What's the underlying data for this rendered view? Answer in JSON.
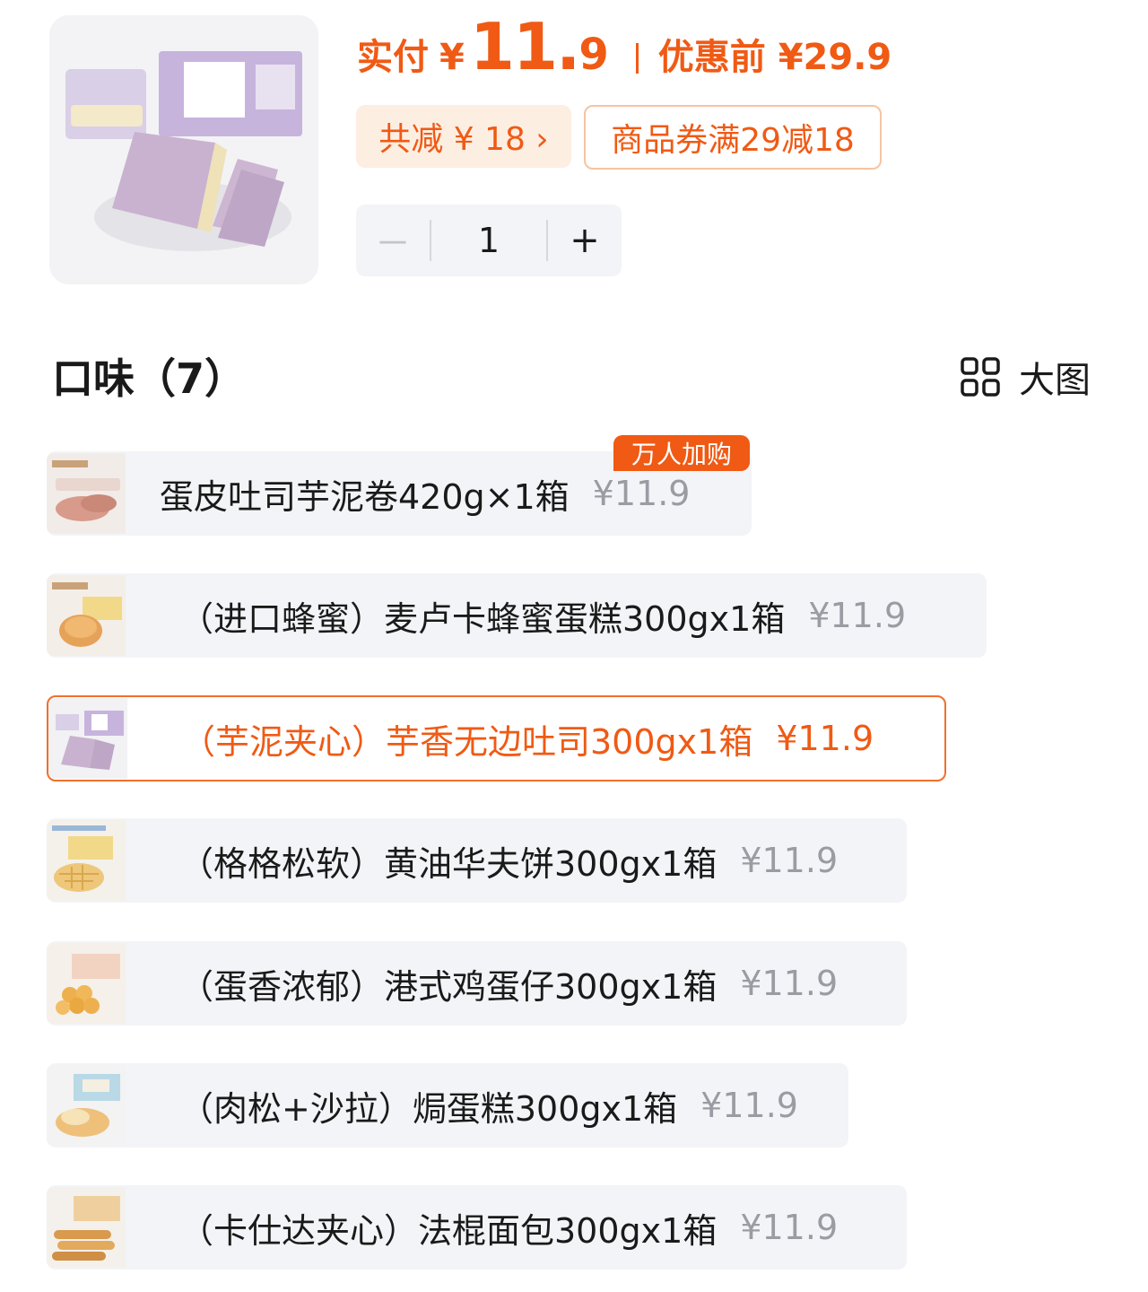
{
  "header": {
    "paid_label": "实付",
    "yen": "¥",
    "price_int": "11.",
    "price_dec": "9",
    "original_label": "优惠前 ¥29.9",
    "discount_tag": "共减 ¥ 18 ›",
    "coupon_tag": "商品券满29减18"
  },
  "stepper": {
    "minus": "－",
    "quantity": "1",
    "plus": "+"
  },
  "section": {
    "title": "口味（7）",
    "view_toggle": "大图"
  },
  "options": [
    {
      "name": "蛋皮吐司芋泥卷420g×1箱",
      "price": "¥11.9",
      "badge": "万人加购",
      "selected": false
    },
    {
      "name": "（进口蜂蜜）麦卢卡蜂蜜蛋糕300gx1箱",
      "price": "¥11.9",
      "selected": false
    },
    {
      "name": "（芋泥夹心）芋香无边吐司300gx1箱",
      "price": "¥11.9",
      "selected": true
    },
    {
      "name": "（格格松软）黄油华夫饼300gx1箱",
      "price": "¥11.9",
      "selected": false
    },
    {
      "name": "（蛋香浓郁）港式鸡蛋仔300gx1箱",
      "price": "¥11.9",
      "selected": false
    },
    {
      "name": "（肉松+沙拉）焗蛋糕300gx1箱",
      "price": "¥11.9",
      "selected": false
    },
    {
      "name": "（卡仕达夹心）法棍面包300gx1箱",
      "price": "¥11.9",
      "selected": false
    }
  ],
  "colors": {
    "accent": "#f05a14",
    "option_bg": "#f3f4f7",
    "muted_price": "#9a9ca3"
  }
}
